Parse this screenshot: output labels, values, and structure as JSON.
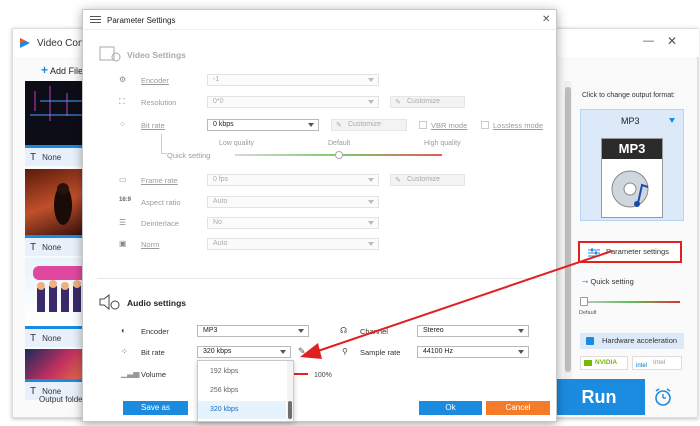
{
  "main_window": {
    "title": "Video Conv",
    "add_files_label": "Add File",
    "output_folder_label": "Output folder:",
    "subtitle_rows": [
      "None",
      "None",
      "None",
      "None"
    ],
    "output_format_hint": "Click to change output format:",
    "format_name": "MP3",
    "format_icon_label": "MP3",
    "parameter_settings_label": "Parameter settings",
    "quick_setting_label": "Quick setting",
    "default_label": "Default",
    "hw_accel_label": "Hardware acceleration",
    "nvidia_label": "NVIDIA",
    "intel_label": "Intel",
    "run_label": "Run"
  },
  "dialog": {
    "title": "Parameter Settings",
    "video_section": "Video Settings",
    "encoder_label": "Encoder",
    "encoder_value": "-1",
    "resolution_label": "Resolution",
    "resolution_value": "0*0",
    "customize_label": "Customize",
    "bitrate_label": "Bit rate",
    "bitrate_value": "0 kbps",
    "vbr_label": "VBR mode",
    "lossless_label": "Lossless mode",
    "quick_setting_label": "Quick setting",
    "low_quality": "Low quality",
    "default": "Default",
    "high_quality": "High quality",
    "framerate_label": "Frame rate",
    "framerate_value": "0 fps",
    "aspect_label": "Aspect ratio",
    "aspect_value": "Auto",
    "deinterlace_label": "Deinterlace",
    "deinterlace_value": "No",
    "norm_label": "Norm",
    "norm_value": "Auto",
    "audio_section": "Audio settings",
    "audio_encoder_label": "Encoder",
    "audio_encoder_value": "MP3",
    "channel_label": "Channel",
    "channel_value": "Stereo",
    "audio_bitrate_label": "Bit rate",
    "audio_bitrate_value": "320 kbps",
    "sample_rate_label": "Sample rate",
    "sample_rate_value": "44100 Hz",
    "volume_label": "Volume",
    "volume_value": "100%",
    "dropdown_options": [
      "192 kbps",
      "256 kbps",
      "320 kbps"
    ],
    "dropdown_selected": "320 kbps",
    "save_as_label": "Save as",
    "ok_label": "Ok",
    "cancel_label": "Cancel"
  },
  "colors": {
    "accent_blue": "#1b8be0",
    "highlight_red": "#e02020",
    "cancel_orange": "#f47c28"
  }
}
